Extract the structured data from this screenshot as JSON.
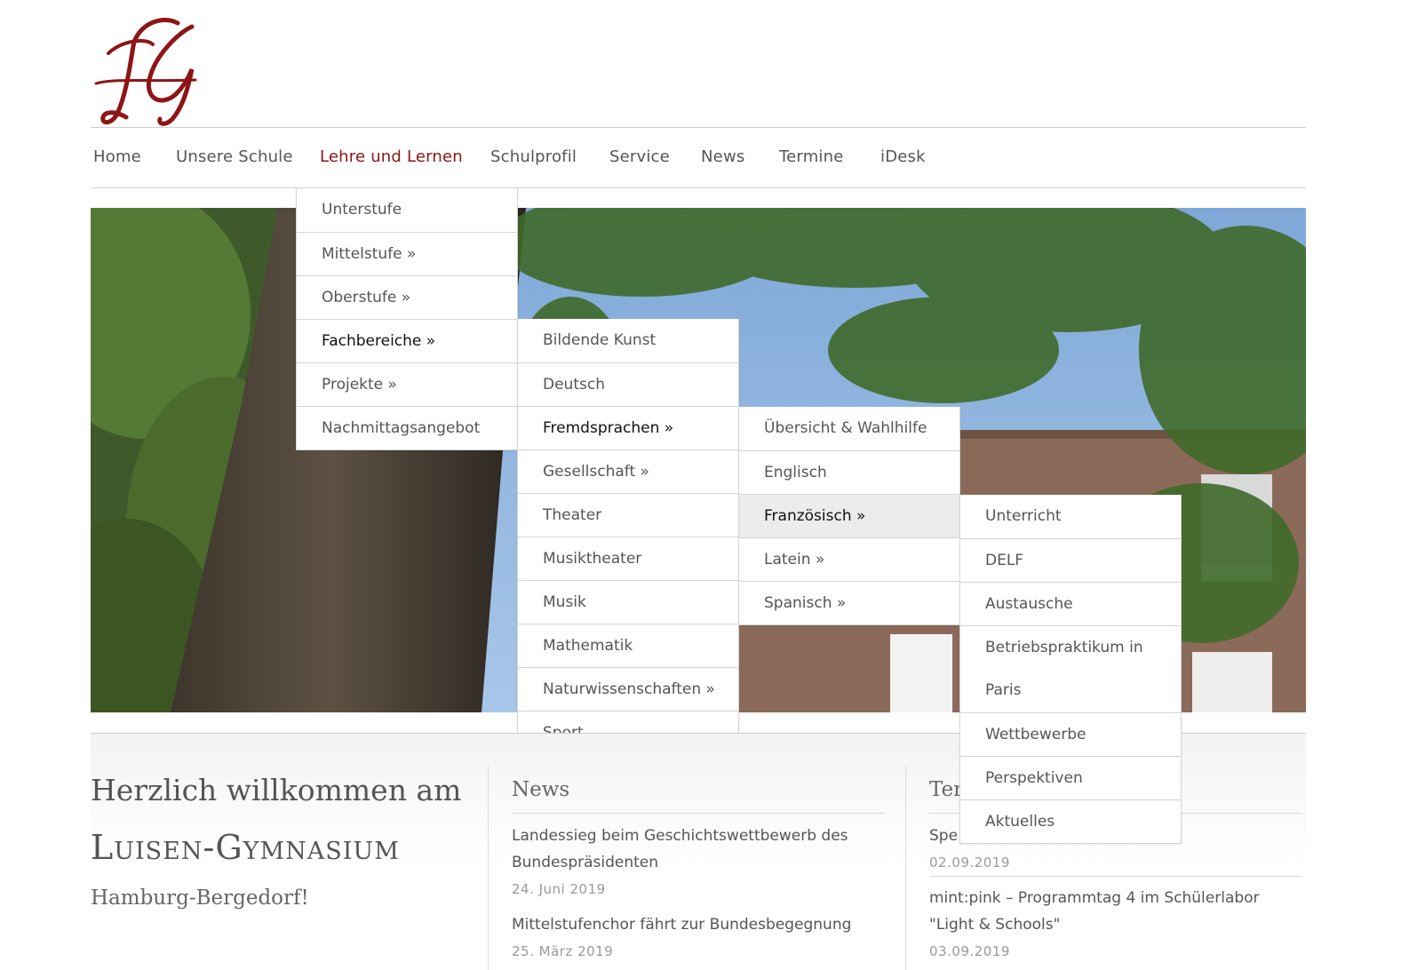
{
  "colors": {
    "accent": "#8e1515",
    "text": "#555555",
    "muted": "#999999",
    "border": "#d4d4d4",
    "highlight": "#ececec"
  },
  "logo": {
    "icon": "lg-monogram-logo",
    "text": "LG"
  },
  "nav": [
    {
      "label": "Home"
    },
    {
      "label": "Unsere Schule"
    },
    {
      "label": "Lehre und Lernen",
      "active": true
    },
    {
      "label": "Schulprofil"
    },
    {
      "label": "Service"
    },
    {
      "label": "News"
    },
    {
      "label": "Termine"
    },
    {
      "label": "iDesk"
    }
  ],
  "menu1": [
    {
      "label": "Unterstufe"
    },
    {
      "label": "Mittelstufe »"
    },
    {
      "label": "Oberstufe »"
    },
    {
      "label": "Fachbereiche »",
      "active": true
    },
    {
      "label": "Projekte »"
    },
    {
      "label": "Nachmittagsangebot"
    }
  ],
  "menu2": [
    {
      "label": "Bildende Kunst"
    },
    {
      "label": "Deutsch"
    },
    {
      "label": "Fremdsprachen »",
      "active": true
    },
    {
      "label": "Gesellschaft »"
    },
    {
      "label": "Theater"
    },
    {
      "label": "Musiktheater"
    },
    {
      "label": "Musik"
    },
    {
      "label": "Mathematik"
    },
    {
      "label": "Naturwissenschaften »"
    },
    {
      "label": "Sport"
    }
  ],
  "menu3": [
    {
      "label": "Übersicht & Wahlhilfe"
    },
    {
      "label": "Englisch"
    },
    {
      "label": "Französisch »",
      "active": true
    },
    {
      "label": "Latein »"
    },
    {
      "label": "Spanisch »"
    }
  ],
  "menu4": [
    {
      "label": "Unterricht"
    },
    {
      "label": "DELF"
    },
    {
      "label": "Austausche"
    },
    {
      "label": "Betriebspraktikum in Paris"
    },
    {
      "label": "Wettbewerbe"
    },
    {
      "label": "Perspektiven"
    },
    {
      "label": "Aktuelles"
    }
  ],
  "welcome": {
    "line1": "Herzlich willkommen am",
    "line2": "Luisen-Gymnasium",
    "line3": "Hamburg-Bergedorf!"
  },
  "news": {
    "title": "News",
    "items": [
      {
        "title": "Landessieg beim Geschichtswettbewerb des Bundespräsidenten",
        "date": "24. Juni 2019"
      },
      {
        "title": "Mittelstufenchor fährt zur Bundesbegegnung",
        "date": "25. März 2019"
      }
    ]
  },
  "termine": {
    "title": "Ter",
    "items": [
      {
        "title": "Spe",
        "date": "02.09.2019"
      },
      {
        "title": "mint:pink – Programmtag 4 im Schülerlabor \"Light & Schools\"",
        "date": "03.09.2019"
      }
    ]
  }
}
